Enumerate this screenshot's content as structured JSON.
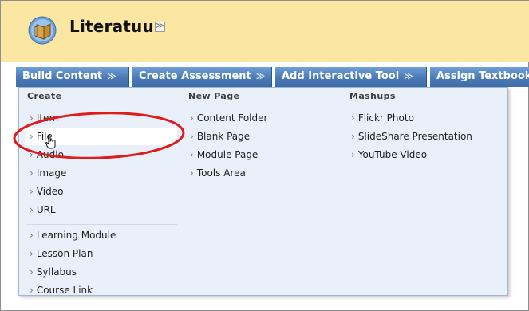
{
  "header": {
    "title": "Literatuur",
    "title_menu_glyph": "≫"
  },
  "toolbar": {
    "buttons": [
      {
        "label": "Build Content"
      },
      {
        "label": "Create Assessment"
      },
      {
        "label": "Add Interactive Tool"
      },
      {
        "label": "Assign Textbook"
      }
    ],
    "arrow_glyph": "≫"
  },
  "menu": {
    "create": {
      "header": "Create",
      "items": [
        "Item",
        "File",
        "Audio",
        "Image",
        "Video",
        "URL",
        "Learning Module",
        "Lesson Plan",
        "Syllabus",
        "Course Link"
      ]
    },
    "new_page": {
      "header": "New Page",
      "items": [
        "Content Folder",
        "Blank Page",
        "Module Page",
        "Tools Area"
      ]
    },
    "mashups": {
      "header": "Mashups",
      "items": [
        "Flickr Photo",
        "SlideShare Presentation",
        "YouTube Video"
      ]
    }
  },
  "item_prefix": "›",
  "colors": {
    "header_band": "#fbe7a2",
    "toolbar": "#4a79b5",
    "menu_bg": "#e9f0fa",
    "annotation": "#e01b1b"
  },
  "icons": [
    "course-book-icon",
    "chevron-down-icon",
    "hand-pointer-icon"
  ]
}
